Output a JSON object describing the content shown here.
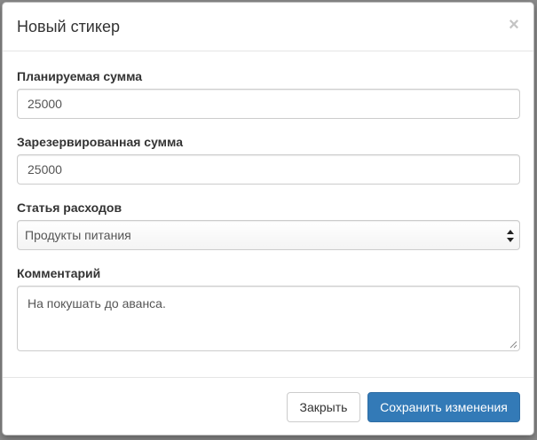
{
  "modal": {
    "title": "Новый стикер",
    "close_symbol": "×"
  },
  "form": {
    "planned_amount": {
      "label": "Планируемая сумма",
      "value": "25000"
    },
    "reserved_amount": {
      "label": "Зарезервированная сумма",
      "value": "25000"
    },
    "expense_category": {
      "label": "Статья расходов",
      "selected": "Продукты питания"
    },
    "comment": {
      "label": "Комментарий",
      "value": "На покушать до аванса."
    }
  },
  "footer": {
    "close_label": "Закрыть",
    "save_label": "Сохранить изменения"
  },
  "colors": {
    "primary": "#337ab7",
    "overlay": "#8a8a8a"
  }
}
